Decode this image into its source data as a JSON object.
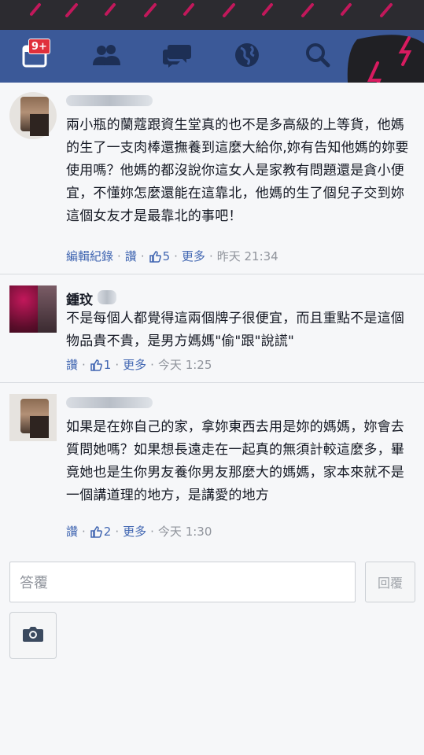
{
  "navbar": {
    "notification_count": "9+",
    "icons": [
      "calendar-icon",
      "friends-icon",
      "messages-icon",
      "globe-icon",
      "search-icon"
    ],
    "accent": "#3b5998"
  },
  "comments": [
    {
      "name": "",
      "body": "兩小瓶的蘭蔻跟資生堂真的也不是多高級的上等貨，他媽的生了一支肉棒還撫養到這麼大給你,妳有告知他媽的妳要使用嗎？他媽的都沒說你這女人是家教有問題還是貪小便宜，不懂妳怎麼還能在這靠北，他媽的生了個兒子交到妳這個女友才是最靠北的事吧！",
      "edit_history": "編輯紀錄",
      "like": "讚",
      "likes": "5",
      "more": "更多",
      "time": "昨天 21:34"
    },
    {
      "name": "鍾玟",
      "body": "不是每個人都覺得這兩個牌子很便宜，而且重點不是這個物品貴不貴，是男方媽媽\"偷\"跟\"說謊\"",
      "like": "讚",
      "likes": "1",
      "more": "更多",
      "time": "今天 1:25"
    },
    {
      "name": "",
      "body": "如果是在妳自己的家，拿妳東西去用是妳的媽媽，妳會去質問她嗎？如果想長遠走在一起真的無須計較這麼多，畢竟她也是生你男友養你男友那麼大的媽媽，家本來就不是一個講道理的地方，是講愛的地方",
      "like": "讚",
      "likes": "2",
      "more": "更多",
      "time": "今天 1:30"
    }
  ],
  "composer": {
    "placeholder": "答覆",
    "reply_label": "回覆",
    "camera_icon": "camera-icon"
  }
}
